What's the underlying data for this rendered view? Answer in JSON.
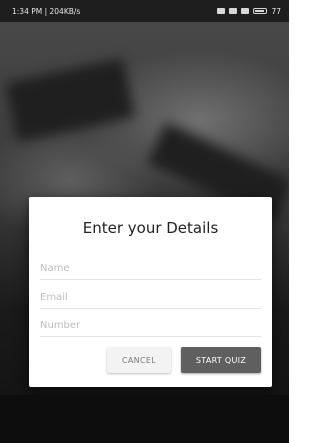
{
  "status_bar": {
    "time_and_speed": "1:34 PM | 204KB/s",
    "battery_percent": "77"
  },
  "dialog": {
    "title": "Enter your Details",
    "fields": [
      {
        "placeholder": "Name",
        "value": ""
      },
      {
        "placeholder": "Email",
        "value": ""
      },
      {
        "placeholder": "Number",
        "value": ""
      }
    ],
    "cancel_label": "CANCEL",
    "start_label": "START QUIZ"
  },
  "colors": {
    "dialog_background": "#ffffff",
    "primary_button": "#5f5f5f",
    "secondary_button": "#f3f3f3",
    "scrim": "#2b2b2b"
  }
}
